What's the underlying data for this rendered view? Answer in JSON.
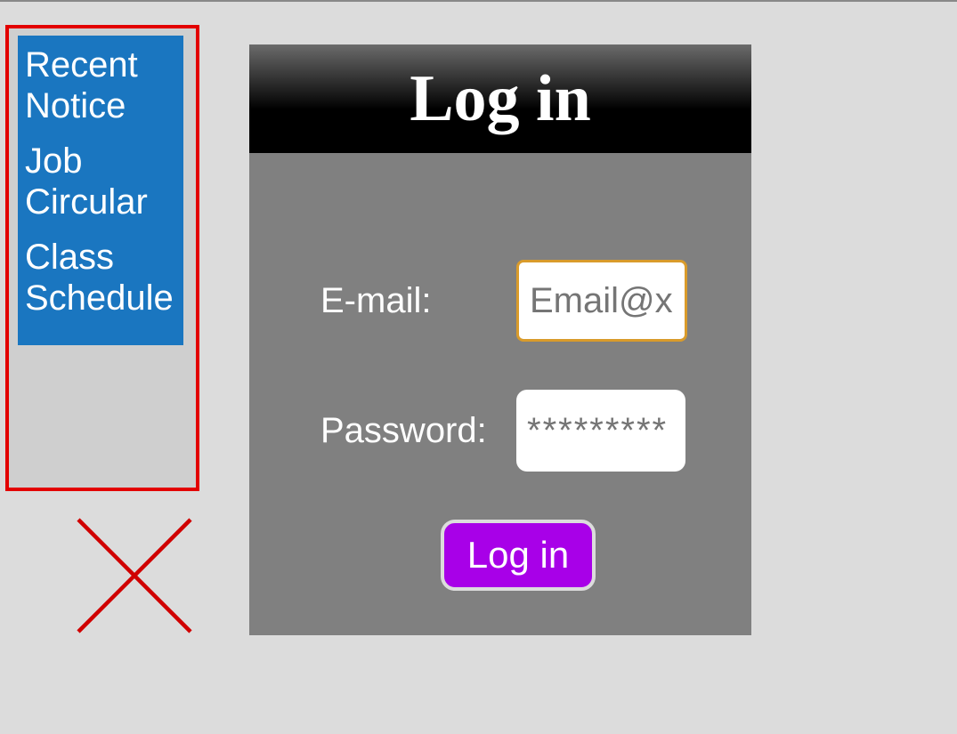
{
  "sidebar": {
    "items": [
      {
        "label": "Recent Notice"
      },
      {
        "label": "Job Circular"
      },
      {
        "label": "Class Schedule"
      }
    ]
  },
  "login": {
    "title": "Log in",
    "email_label": "E-mail:",
    "email_placeholder": "Email@x",
    "password_label": "Password:",
    "password_placeholder": "*********",
    "submit_label": "Log in"
  }
}
